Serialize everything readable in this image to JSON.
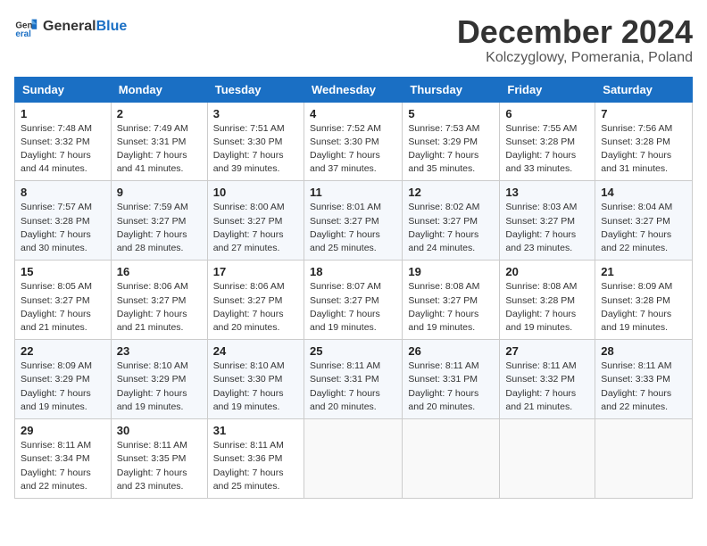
{
  "header": {
    "logo": {
      "text_general": "General",
      "text_blue": "Blue"
    },
    "title": "December 2024",
    "subtitle": "Kolczyglowy, Pomerania, Poland"
  },
  "days_of_week": [
    "Sunday",
    "Monday",
    "Tuesday",
    "Wednesday",
    "Thursday",
    "Friday",
    "Saturday"
  ],
  "weeks": [
    [
      {
        "day": "1",
        "sunrise": "Sunrise: 7:48 AM",
        "sunset": "Sunset: 3:32 PM",
        "daylight": "Daylight: 7 hours and 44 minutes."
      },
      {
        "day": "2",
        "sunrise": "Sunrise: 7:49 AM",
        "sunset": "Sunset: 3:31 PM",
        "daylight": "Daylight: 7 hours and 41 minutes."
      },
      {
        "day": "3",
        "sunrise": "Sunrise: 7:51 AM",
        "sunset": "Sunset: 3:30 PM",
        "daylight": "Daylight: 7 hours and 39 minutes."
      },
      {
        "day": "4",
        "sunrise": "Sunrise: 7:52 AM",
        "sunset": "Sunset: 3:30 PM",
        "daylight": "Daylight: 7 hours and 37 minutes."
      },
      {
        "day": "5",
        "sunrise": "Sunrise: 7:53 AM",
        "sunset": "Sunset: 3:29 PM",
        "daylight": "Daylight: 7 hours and 35 minutes."
      },
      {
        "day": "6",
        "sunrise": "Sunrise: 7:55 AM",
        "sunset": "Sunset: 3:28 PM",
        "daylight": "Daylight: 7 hours and 33 minutes."
      },
      {
        "day": "7",
        "sunrise": "Sunrise: 7:56 AM",
        "sunset": "Sunset: 3:28 PM",
        "daylight": "Daylight: 7 hours and 31 minutes."
      }
    ],
    [
      {
        "day": "8",
        "sunrise": "Sunrise: 7:57 AM",
        "sunset": "Sunset: 3:28 PM",
        "daylight": "Daylight: 7 hours and 30 minutes."
      },
      {
        "day": "9",
        "sunrise": "Sunrise: 7:59 AM",
        "sunset": "Sunset: 3:27 PM",
        "daylight": "Daylight: 7 hours and 28 minutes."
      },
      {
        "day": "10",
        "sunrise": "Sunrise: 8:00 AM",
        "sunset": "Sunset: 3:27 PM",
        "daylight": "Daylight: 7 hours and 27 minutes."
      },
      {
        "day": "11",
        "sunrise": "Sunrise: 8:01 AM",
        "sunset": "Sunset: 3:27 PM",
        "daylight": "Daylight: 7 hours and 25 minutes."
      },
      {
        "day": "12",
        "sunrise": "Sunrise: 8:02 AM",
        "sunset": "Sunset: 3:27 PM",
        "daylight": "Daylight: 7 hours and 24 minutes."
      },
      {
        "day": "13",
        "sunrise": "Sunrise: 8:03 AM",
        "sunset": "Sunset: 3:27 PM",
        "daylight": "Daylight: 7 hours and 23 minutes."
      },
      {
        "day": "14",
        "sunrise": "Sunrise: 8:04 AM",
        "sunset": "Sunset: 3:27 PM",
        "daylight": "Daylight: 7 hours and 22 minutes."
      }
    ],
    [
      {
        "day": "15",
        "sunrise": "Sunrise: 8:05 AM",
        "sunset": "Sunset: 3:27 PM",
        "daylight": "Daylight: 7 hours and 21 minutes."
      },
      {
        "day": "16",
        "sunrise": "Sunrise: 8:06 AM",
        "sunset": "Sunset: 3:27 PM",
        "daylight": "Daylight: 7 hours and 21 minutes."
      },
      {
        "day": "17",
        "sunrise": "Sunrise: 8:06 AM",
        "sunset": "Sunset: 3:27 PM",
        "daylight": "Daylight: 7 hours and 20 minutes."
      },
      {
        "day": "18",
        "sunrise": "Sunrise: 8:07 AM",
        "sunset": "Sunset: 3:27 PM",
        "daylight": "Daylight: 7 hours and 19 minutes."
      },
      {
        "day": "19",
        "sunrise": "Sunrise: 8:08 AM",
        "sunset": "Sunset: 3:27 PM",
        "daylight": "Daylight: 7 hours and 19 minutes."
      },
      {
        "day": "20",
        "sunrise": "Sunrise: 8:08 AM",
        "sunset": "Sunset: 3:28 PM",
        "daylight": "Daylight: 7 hours and 19 minutes."
      },
      {
        "day": "21",
        "sunrise": "Sunrise: 8:09 AM",
        "sunset": "Sunset: 3:28 PM",
        "daylight": "Daylight: 7 hours and 19 minutes."
      }
    ],
    [
      {
        "day": "22",
        "sunrise": "Sunrise: 8:09 AM",
        "sunset": "Sunset: 3:29 PM",
        "daylight": "Daylight: 7 hours and 19 minutes."
      },
      {
        "day": "23",
        "sunrise": "Sunrise: 8:10 AM",
        "sunset": "Sunset: 3:29 PM",
        "daylight": "Daylight: 7 hours and 19 minutes."
      },
      {
        "day": "24",
        "sunrise": "Sunrise: 8:10 AM",
        "sunset": "Sunset: 3:30 PM",
        "daylight": "Daylight: 7 hours and 19 minutes."
      },
      {
        "day": "25",
        "sunrise": "Sunrise: 8:11 AM",
        "sunset": "Sunset: 3:31 PM",
        "daylight": "Daylight: 7 hours and 20 minutes."
      },
      {
        "day": "26",
        "sunrise": "Sunrise: 8:11 AM",
        "sunset": "Sunset: 3:31 PM",
        "daylight": "Daylight: 7 hours and 20 minutes."
      },
      {
        "day": "27",
        "sunrise": "Sunrise: 8:11 AM",
        "sunset": "Sunset: 3:32 PM",
        "daylight": "Daylight: 7 hours and 21 minutes."
      },
      {
        "day": "28",
        "sunrise": "Sunrise: 8:11 AM",
        "sunset": "Sunset: 3:33 PM",
        "daylight": "Daylight: 7 hours and 22 minutes."
      }
    ],
    [
      {
        "day": "29",
        "sunrise": "Sunrise: 8:11 AM",
        "sunset": "Sunset: 3:34 PM",
        "daylight": "Daylight: 7 hours and 22 minutes."
      },
      {
        "day": "30",
        "sunrise": "Sunrise: 8:11 AM",
        "sunset": "Sunset: 3:35 PM",
        "daylight": "Daylight: 7 hours and 23 minutes."
      },
      {
        "day": "31",
        "sunrise": "Sunrise: 8:11 AM",
        "sunset": "Sunset: 3:36 PM",
        "daylight": "Daylight: 7 hours and 25 minutes."
      },
      null,
      null,
      null,
      null
    ]
  ]
}
